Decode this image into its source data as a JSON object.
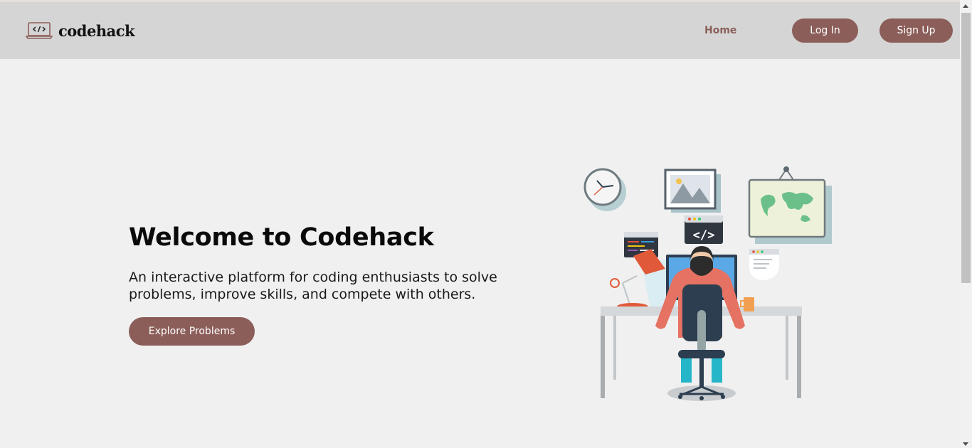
{
  "brand": {
    "name": "codehack",
    "logo_icon": "laptop-code-icon"
  },
  "nav": {
    "home": "Home",
    "login": "Log In",
    "signup": "Sign Up"
  },
  "hero": {
    "title": "Welcome to Codehack",
    "subtitle": "An interactive platform for coding enthusiasts to solve problems, improve skills, and compete with others.",
    "cta": "Explore Problems"
  },
  "illustration": {
    "code_tag": "</>"
  },
  "colors": {
    "accent": "#8c5e5a",
    "navbar": "#d5d5d5",
    "background": "#f0f0f0"
  }
}
